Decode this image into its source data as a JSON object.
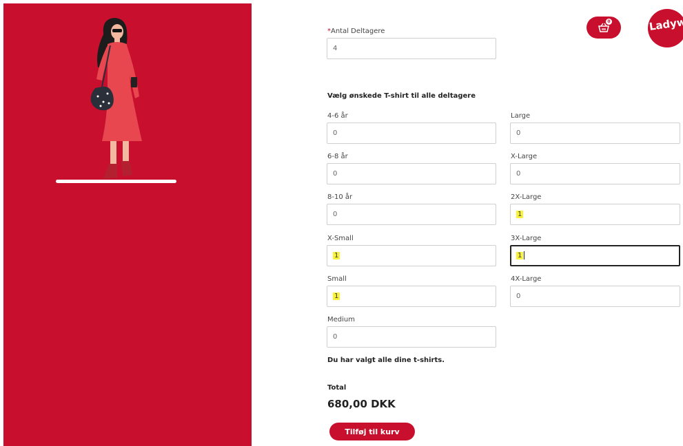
{
  "participants": {
    "label_required_mark": "*",
    "label": "Antal Deltagere",
    "value": "4"
  },
  "tshirts": {
    "title": "Vælg ønskede T-shirt til alle deltagere",
    "left_column": [
      {
        "label": "4-6 år",
        "value": "0"
      },
      {
        "label": "6-8 år",
        "value": "0"
      },
      {
        "label": "8-10 år",
        "value": "0"
      },
      {
        "label": "X-Small",
        "value": "1"
      },
      {
        "label": "Small",
        "value": "1"
      },
      {
        "label": "Medium",
        "value": "0"
      }
    ],
    "right_column": [
      {
        "label": "Large",
        "value": "0"
      },
      {
        "label": "X-Large",
        "value": "0"
      },
      {
        "label": "2X-Large",
        "value": "1"
      },
      {
        "label": "3X-Large",
        "value": "1"
      },
      {
        "label": "4X-Large",
        "value": "0"
      }
    ]
  },
  "status_message": "Du har valgt alle dine t-shirts.",
  "total": {
    "label": "Total",
    "value": "680,00 DKK"
  },
  "add_to_cart_label": "Tilføj til kurv",
  "cart": {
    "icon": "basket-icon",
    "badge": "0"
  },
  "logo": {
    "text": "Ladywalk"
  },
  "colors": {
    "brand_red": "#c8102e",
    "highlight": "#f9f23a"
  }
}
